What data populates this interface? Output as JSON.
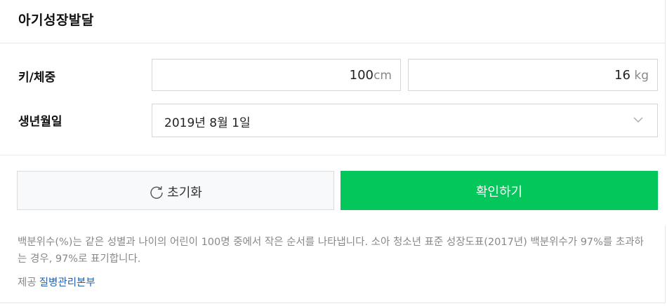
{
  "header": {
    "title": "아기성장발달"
  },
  "form": {
    "height_weight_label": "키/체중",
    "height": {
      "value": "100",
      "unit": "cm"
    },
    "weight": {
      "value": "16",
      "unit": "kg"
    },
    "birthdate_label": "생년월일",
    "birthdate_value": "2019년 8월 1일"
  },
  "buttons": {
    "reset_label": "초기화",
    "confirm_label": "확인하기"
  },
  "note": {
    "description": "백분위수(%)는 같은 성별과 나이의 어린이 100명 중에서 작은 순서를 나타냅니다. 소아 청소년 표준 성장도표(2017년) 백분위수가 97%를 초과하는 경우, 97%로 표기합니다.",
    "source_prefix": "제공",
    "source_link": "질병관리본부"
  },
  "icons": {
    "reset": "refresh-icon",
    "dropdown": "chevron-down-icon"
  },
  "colors": {
    "confirm": "#03c75a",
    "link": "#1f5fb0"
  }
}
